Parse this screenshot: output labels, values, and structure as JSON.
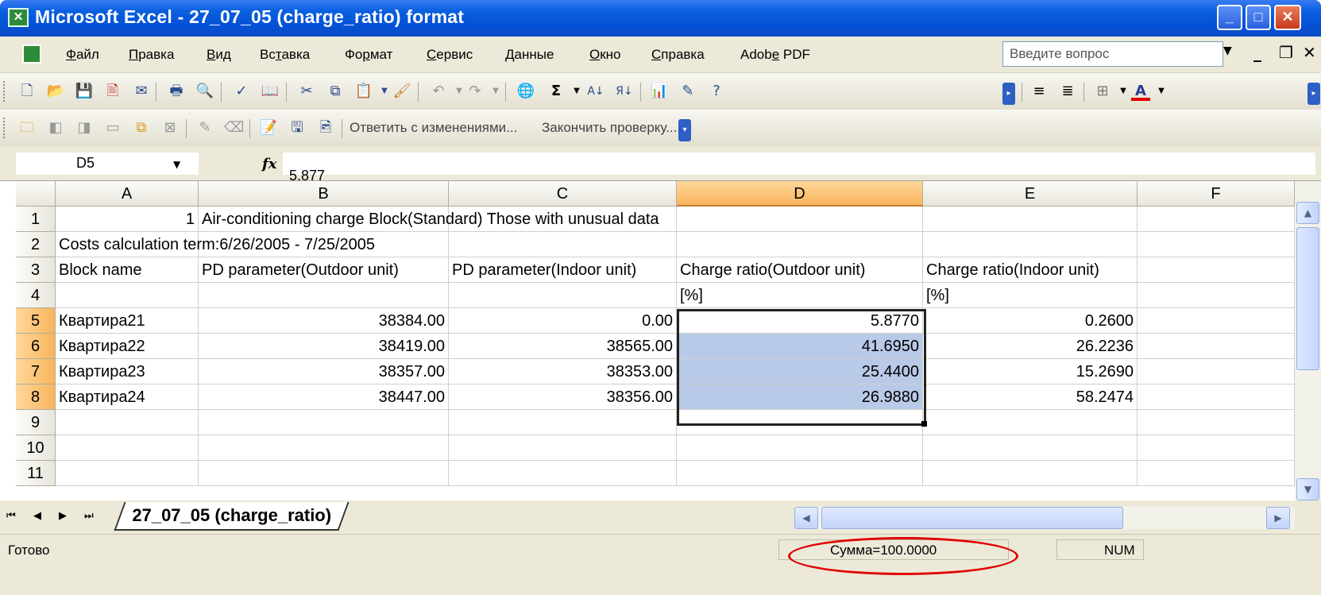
{
  "window": {
    "title": "Microsoft Excel - 27_07_05 (charge_ratio) format"
  },
  "menu": {
    "items": [
      "Файл",
      "Правка",
      "Вид",
      "Вставка",
      "Формат",
      "Сервис",
      "Данные",
      "Окно",
      "Справка",
      "Adobe PDF"
    ],
    "help_placeholder": "Введите вопрос"
  },
  "review_toolbar": {
    "reply_label": "Ответить с изменениями...",
    "end_review_label": "Закончить проверку..."
  },
  "formula_bar": {
    "name_box": "D5",
    "formula": "5.877"
  },
  "sheet": {
    "columns": [
      "A",
      "B",
      "C",
      "D",
      "E",
      "F"
    ],
    "selected_column": "D",
    "rows": [
      {
        "num": "1",
        "cells": [
          "1",
          "Air-conditioning charge  Block(Standard)   Those with unusual data",
          "",
          "",
          "",
          ""
        ]
      },
      {
        "num": "2",
        "cells": [
          "Costs calculation term:6/26/2005 - 7/25/2005",
          "",
          "",
          "",
          "",
          ""
        ]
      },
      {
        "num": "3",
        "cells": [
          "Block name",
          "PD parameter(Outdoor unit)",
          "PD parameter(Indoor unit)",
          "Charge ratio(Outdoor unit)",
          "Charge ratio(Indoor unit)",
          ""
        ]
      },
      {
        "num": "4",
        "cells": [
          "",
          "",
          "",
          "[%]",
          "[%]",
          ""
        ]
      },
      {
        "num": "5",
        "cells": [
          "Квартира21",
          "38384.00",
          "0.00",
          "5.8770",
          "0.2600",
          ""
        ]
      },
      {
        "num": "6",
        "cells": [
          "Квартира22",
          "38419.00",
          "38565.00",
          "41.6950",
          "26.2236",
          ""
        ]
      },
      {
        "num": "7",
        "cells": [
          "Квартира23",
          "38357.00",
          "38353.00",
          "25.4400",
          "15.2690",
          ""
        ]
      },
      {
        "num": "8",
        "cells": [
          "Квартира24",
          "38447.00",
          "38356.00",
          "26.9880",
          "58.2474",
          ""
        ]
      },
      {
        "num": "9",
        "cells": [
          "",
          "",
          "",
          "",
          "",
          ""
        ]
      },
      {
        "num": "10",
        "cells": [
          "",
          "",
          "",
          "",
          "",
          ""
        ]
      },
      {
        "num": "11",
        "cells": [
          "",
          "",
          "",
          "",
          "",
          ""
        ]
      }
    ],
    "tab_name": "27_07_05 (charge_ratio)"
  },
  "status": {
    "ready": "Готово",
    "sum": "Сумма=100.0000",
    "num": "NUM"
  },
  "colors": {
    "title_bar": "#0551d6",
    "selection_fill": "#b9c9e8",
    "header_selected": "#f8b55d",
    "annotation": "#e00000"
  }
}
